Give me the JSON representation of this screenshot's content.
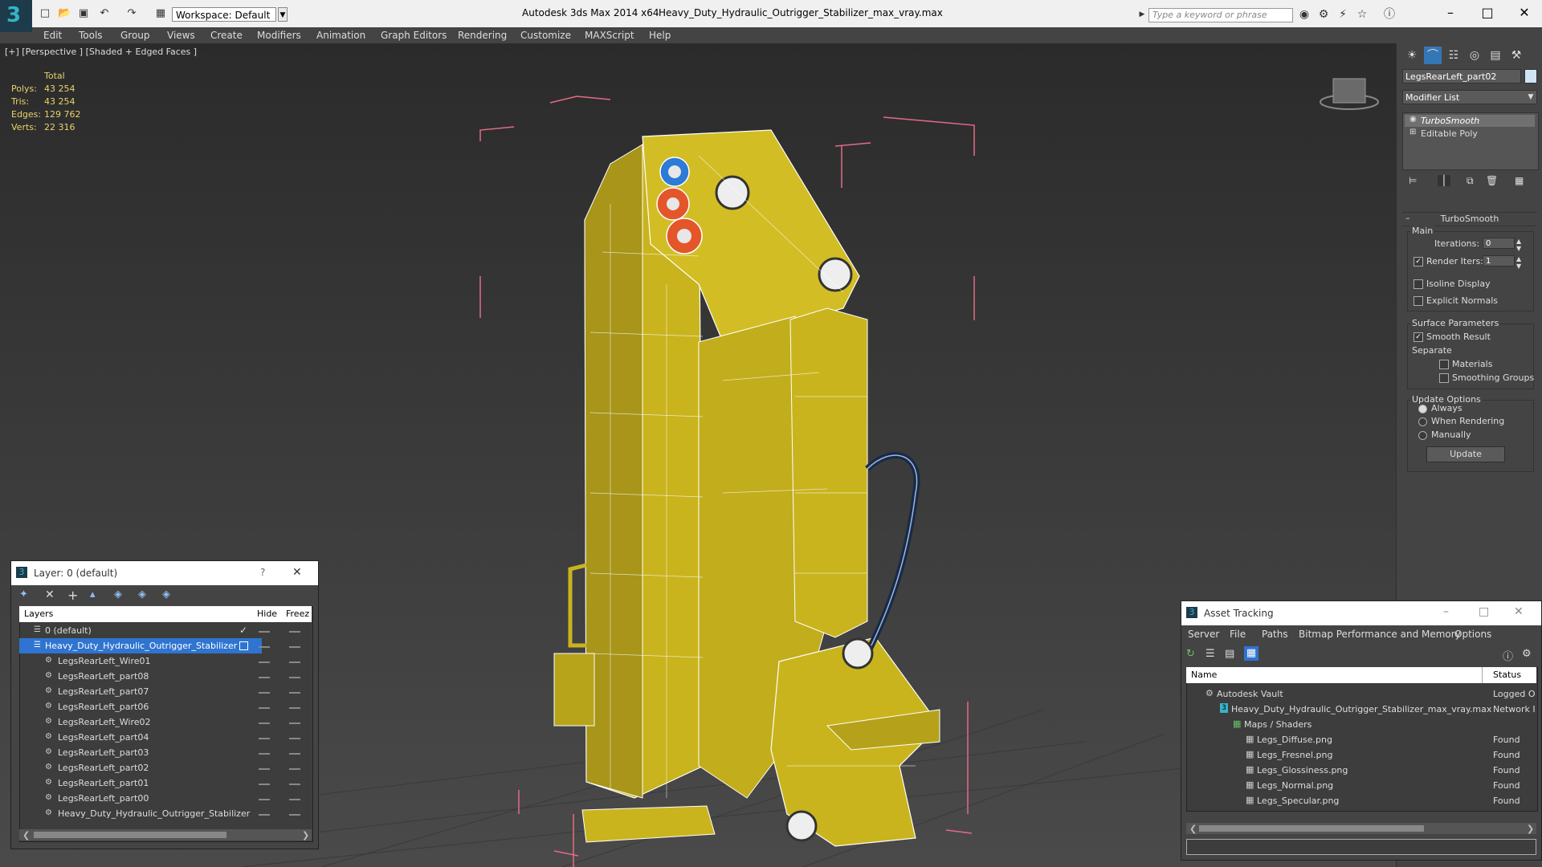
{
  "titlebar": {
    "workspace": "Workspace: Default",
    "app_title": "Autodesk 3ds Max  2014 x64",
    "file_title": "Heavy_Duty_Hydraulic_Outrigger_Stabilizer_max_vray.max",
    "search_placeholder": "Type a keyword or phrase"
  },
  "menu": [
    "Edit",
    "Tools",
    "Group",
    "Views",
    "Create",
    "Modifiers",
    "Animation",
    "Graph Editors",
    "Rendering",
    "Customize",
    "MAXScript",
    "Help"
  ],
  "viewport": {
    "label": "[+] [Perspective ] [Shaded + Edged Faces ]",
    "stats": {
      "header": "Total",
      "rows": [
        {
          "label": "Polys:",
          "value": "43 254"
        },
        {
          "label": "Tris:",
          "value": "43 254"
        },
        {
          "label": "Edges:",
          "value": "129 762"
        },
        {
          "label": "Verts:",
          "value": "22 316"
        }
      ]
    },
    "colors": {
      "model": "#c9b41e",
      "model_dark": "#8e7e10",
      "wire": "#ffffff",
      "bbox": "#e56a87"
    }
  },
  "command_panel": {
    "object_name": "LegsRearLeft_part02",
    "modifier_list": "Modifier List",
    "stack": [
      "TurboSmooth",
      "Editable Poly"
    ],
    "turbosmooth": {
      "title": "TurboSmooth",
      "main_label": "Main",
      "iterations_label": "Iterations:",
      "iterations_value": "0",
      "render_iters_label": "Render Iters:",
      "render_iters_value": "1",
      "isoline": "Isoline Display",
      "explicit_normals": "Explicit Normals",
      "surface_params": "Surface Parameters",
      "smooth_result": "Smooth Result",
      "separate": "Separate",
      "materials": "Materials",
      "smoothing_groups": "Smoothing Groups",
      "update_options": "Update Options",
      "always": "Always",
      "when_rendering": "When Rendering",
      "manually": "Manually",
      "update_button": "Update"
    }
  },
  "layer_dialog": {
    "title": "Layer: 0 (default)",
    "help": "?",
    "columns": [
      "Layers",
      "Hide",
      "Freez"
    ],
    "rows": [
      "0 (default)",
      "Heavy_Duty_Hydraulic_Outrigger_Stabilizer",
      "LegsRearLeft_Wire01",
      "LegsRearLeft_part08",
      "LegsRearLeft_part07",
      "LegsRearLeft_part06",
      "LegsRearLeft_Wire02",
      "LegsRearLeft_part04",
      "LegsRearLeft_part03",
      "LegsRearLeft_part02",
      "LegsRearLeft_part01",
      "LegsRearLeft_part00",
      "Heavy_Duty_Hydraulic_Outrigger_Stabilizer"
    ]
  },
  "asset_tracking": {
    "title": "Asset Tracking",
    "menu": [
      "Server",
      "File",
      "Paths",
      "Bitmap Performance and Memory",
      "Options"
    ],
    "columns": [
      "Name",
      "Status"
    ],
    "rows": [
      {
        "name": "Autodesk Vault",
        "status": "Logged O"
      },
      {
        "name": "Heavy_Duty_Hydraulic_Outrigger_Stabilizer_max_vray.max",
        "status": "Network I"
      },
      {
        "name": "Maps / Shaders",
        "status": ""
      },
      {
        "name": "Legs_Diffuse.png",
        "status": "Found"
      },
      {
        "name": "Legs_Fresnel.png",
        "status": "Found"
      },
      {
        "name": "Legs_Glossiness.png",
        "status": "Found"
      },
      {
        "name": "Legs_Normal.png",
        "status": "Found"
      },
      {
        "name": "Legs_Specular.png",
        "status": "Found"
      }
    ]
  }
}
